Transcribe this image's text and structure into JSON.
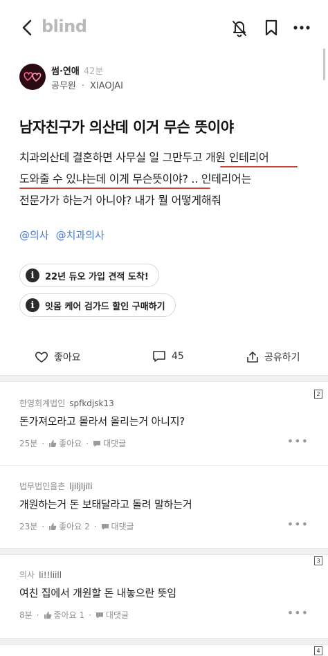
{
  "header": {
    "logo": "blind"
  },
  "author": {
    "category": "썸·연애",
    "time": "42분",
    "company": "공무원",
    "nickname": "XIAOJAI"
  },
  "post": {
    "title": "남자친구가 의산데 이거 무슨 뜻이야",
    "body_lines": [
      "치과의산데 결혼하면 사무실 일 그만두고 개원 인테리어",
      "도와줄 수 있냐는데 이게 무슨뜻이야? .. 인테리어는",
      "전문가가  하는거 아니야? 내가 뭘 어떻게해줘"
    ],
    "tags": [
      "@의사",
      "@치과의사"
    ],
    "notices": [
      "22년 듀오 가입 견적 도착!",
      "잇몸 케어 검가드 할인 구매하기"
    ]
  },
  "actions": {
    "like_label": "좋아요",
    "comment_count": "45",
    "share_label": "공유하기"
  },
  "comments": [
    {
      "company": "한영회계법인",
      "nickname": "spfkdjsk13",
      "text": "돈가져오라고 몰라서 올리는거 아니지?",
      "time": "25분",
      "like_label": "좋아요",
      "reply_label": "대댓글",
      "page_badge": "2"
    },
    {
      "company": "법무법인율촌",
      "nickname": "ljiljljili",
      "text": "개원하는거 돈 보태달라고 돌려 말하는거",
      "time": "23분",
      "like_label": "좋아요 2",
      "reply_label": "대댓글",
      "page_badge": ""
    },
    {
      "company": "의사",
      "nickname": "li!!liill",
      "text": "여친 집에서 개원할 돈 내놓으란 뜻임",
      "time": "8분",
      "like_label": "좋아요 1",
      "reply_label": "대댓글",
      "page_badge": "3"
    }
  ],
  "bottom_badge": "4",
  "colors": {
    "accent_tag": "#4a7bd0",
    "underline_red": "#c8413a",
    "logo_gray": "#b9b9b9"
  },
  "icons": [
    "back-arrow-icon",
    "bell-off-icon",
    "bookmark-icon",
    "more-dots-icon",
    "info-icon",
    "heart-icon",
    "comment-icon",
    "share-icon",
    "thumbs-up-icon",
    "reply-bubble-icon"
  ]
}
